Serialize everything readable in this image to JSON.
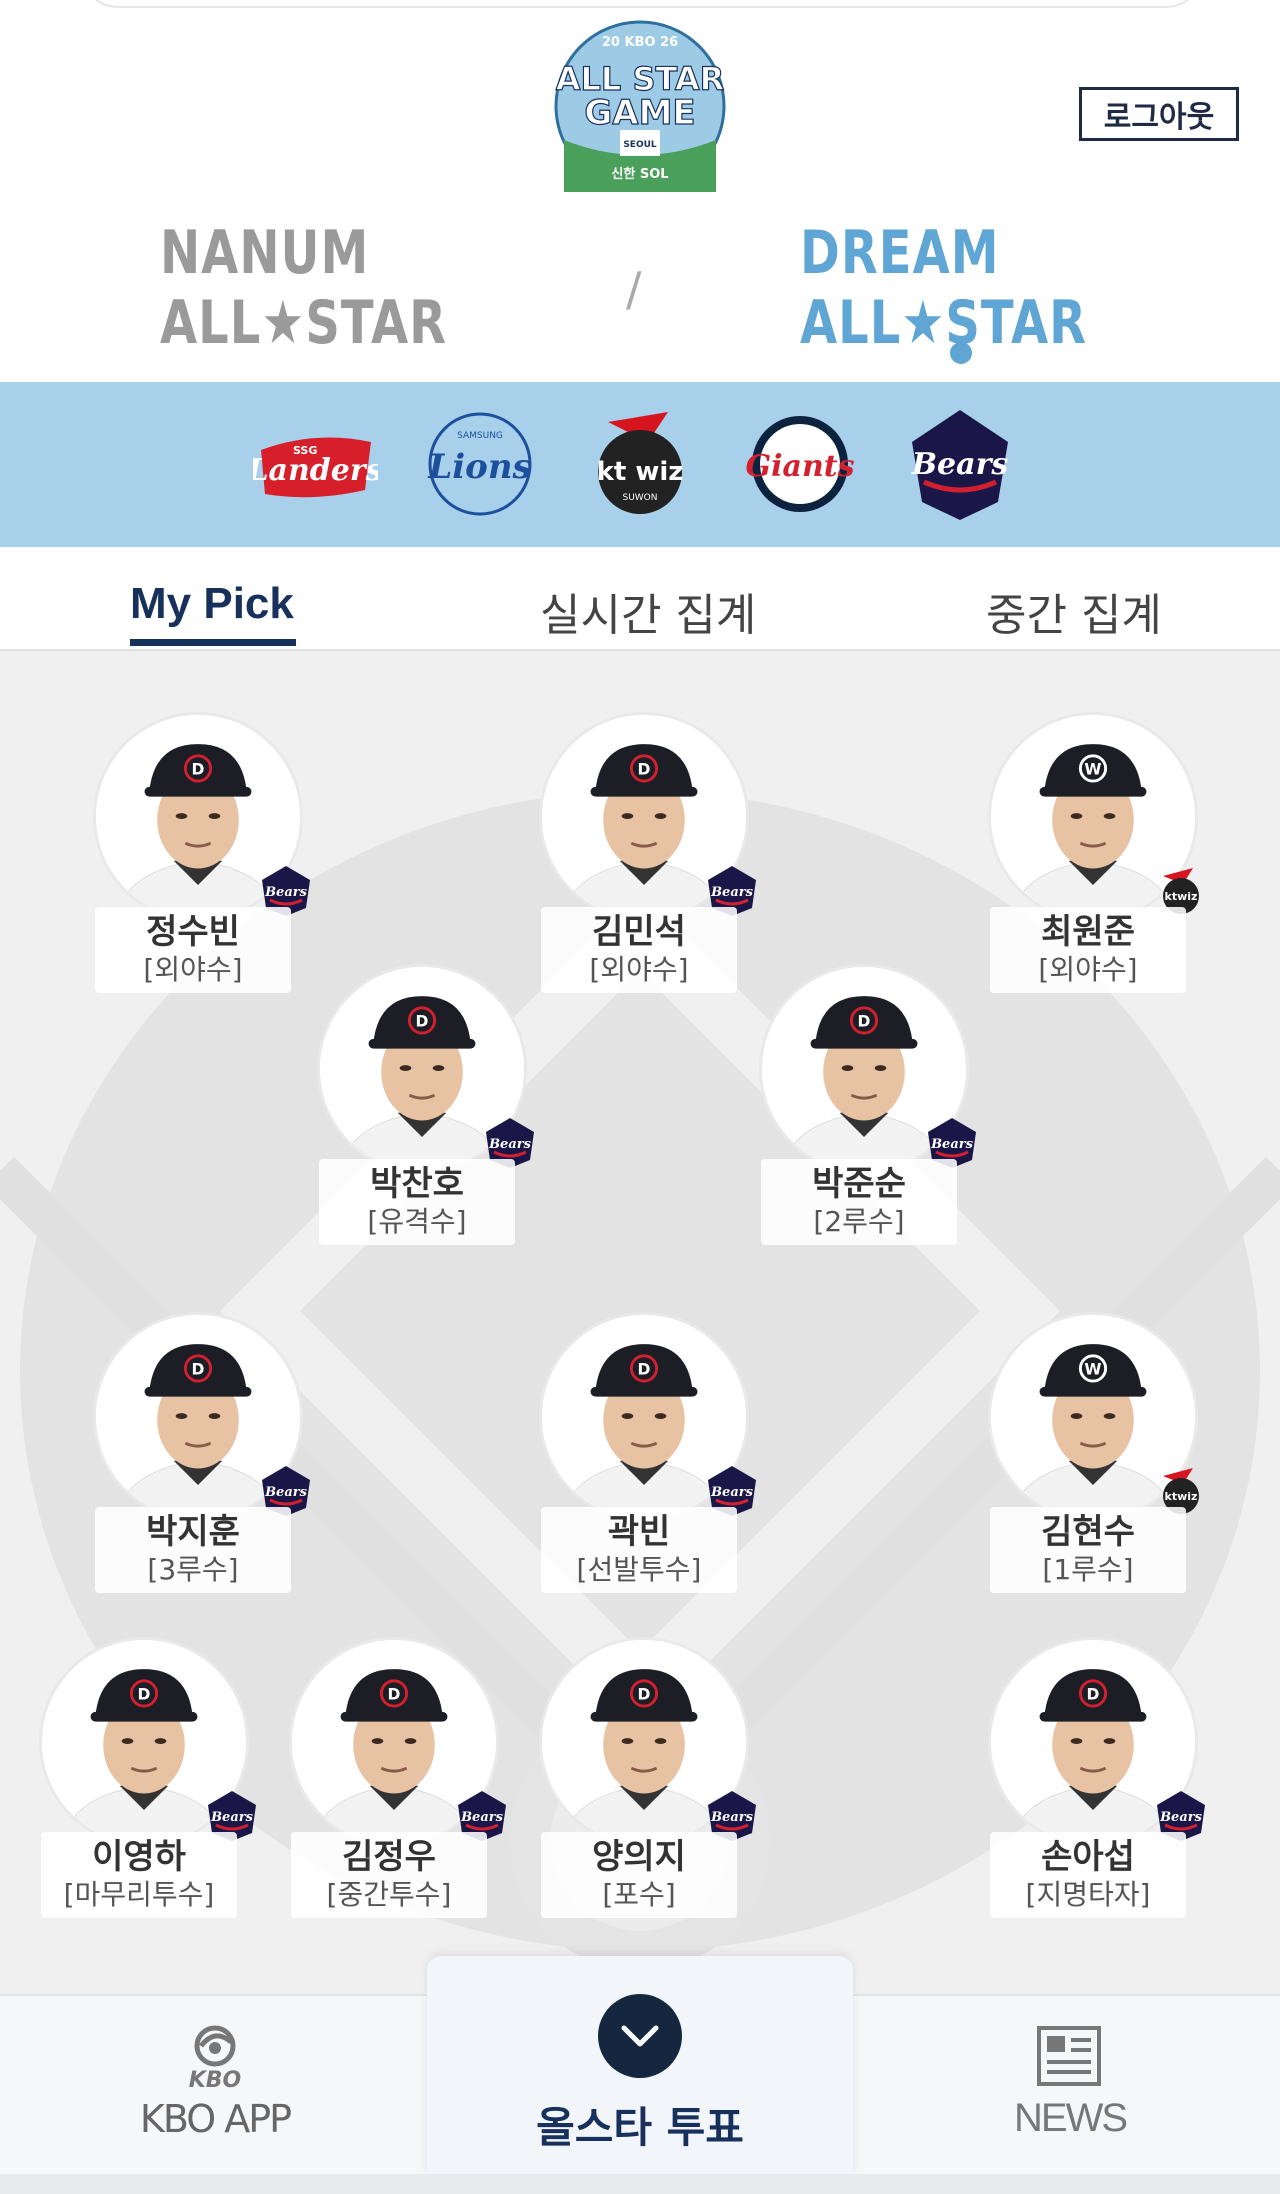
{
  "header": {
    "event_logo_text": [
      "20 KBO 26",
      "ALL STAR",
      "GAME",
      "SEOUL",
      "신한 SOL"
    ],
    "logout_label": "로그아웃",
    "team_tabs": [
      {
        "label": "NANUM ALL★STAR",
        "selected": false
      },
      {
        "label": "DREAM ALL★STAR",
        "selected": true
      }
    ],
    "divider": "/"
  },
  "teams": [
    "SSG Landers",
    "Samsung Lions",
    "kt wiz",
    "Lotte Giants",
    "Doosan Bears"
  ],
  "tabs": [
    {
      "label": "My Pick",
      "selected": true
    },
    {
      "label": "실시간 집계",
      "selected": false
    },
    {
      "label": "중간 집계",
      "selected": false
    }
  ],
  "players": [
    {
      "name": "정수빈",
      "position": "[외야수]",
      "team": "bears"
    },
    {
      "name": "김민석",
      "position": "[외야수]",
      "team": "bears"
    },
    {
      "name": "최원준",
      "position": "[외야수]",
      "team": "ktwiz"
    },
    {
      "name": "박찬호",
      "position": "[유격수]",
      "team": "bears"
    },
    {
      "name": "박준순",
      "position": "[2루수]",
      "team": "bears"
    },
    {
      "name": "박지훈",
      "position": "[3루수]",
      "team": "bears"
    },
    {
      "name": "곽빈",
      "position": "[선발투수]",
      "team": "bears"
    },
    {
      "name": "김현수",
      "position": "[1루수]",
      "team": "ktwiz"
    },
    {
      "name": "이영하",
      "position": "[마무리투수]",
      "team": "bears"
    },
    {
      "name": "김정우",
      "position": "[중간투수]",
      "team": "bears"
    },
    {
      "name": "양의지",
      "position": "[포수]",
      "team": "bears"
    },
    {
      "name": "손아섭",
      "position": "[지명타자]",
      "team": "bears"
    }
  ],
  "bottom_nav": {
    "kbo_small": "KBO",
    "kbo_label": "KBO APP",
    "vote_label": "올스타 투표",
    "news_label": "NEWS"
  },
  "colors": {
    "navy": "#17305c",
    "dream_blue": "#5fa6d4",
    "team_strip": "#a8d0ea",
    "field_bg": "#f0f0f0"
  }
}
